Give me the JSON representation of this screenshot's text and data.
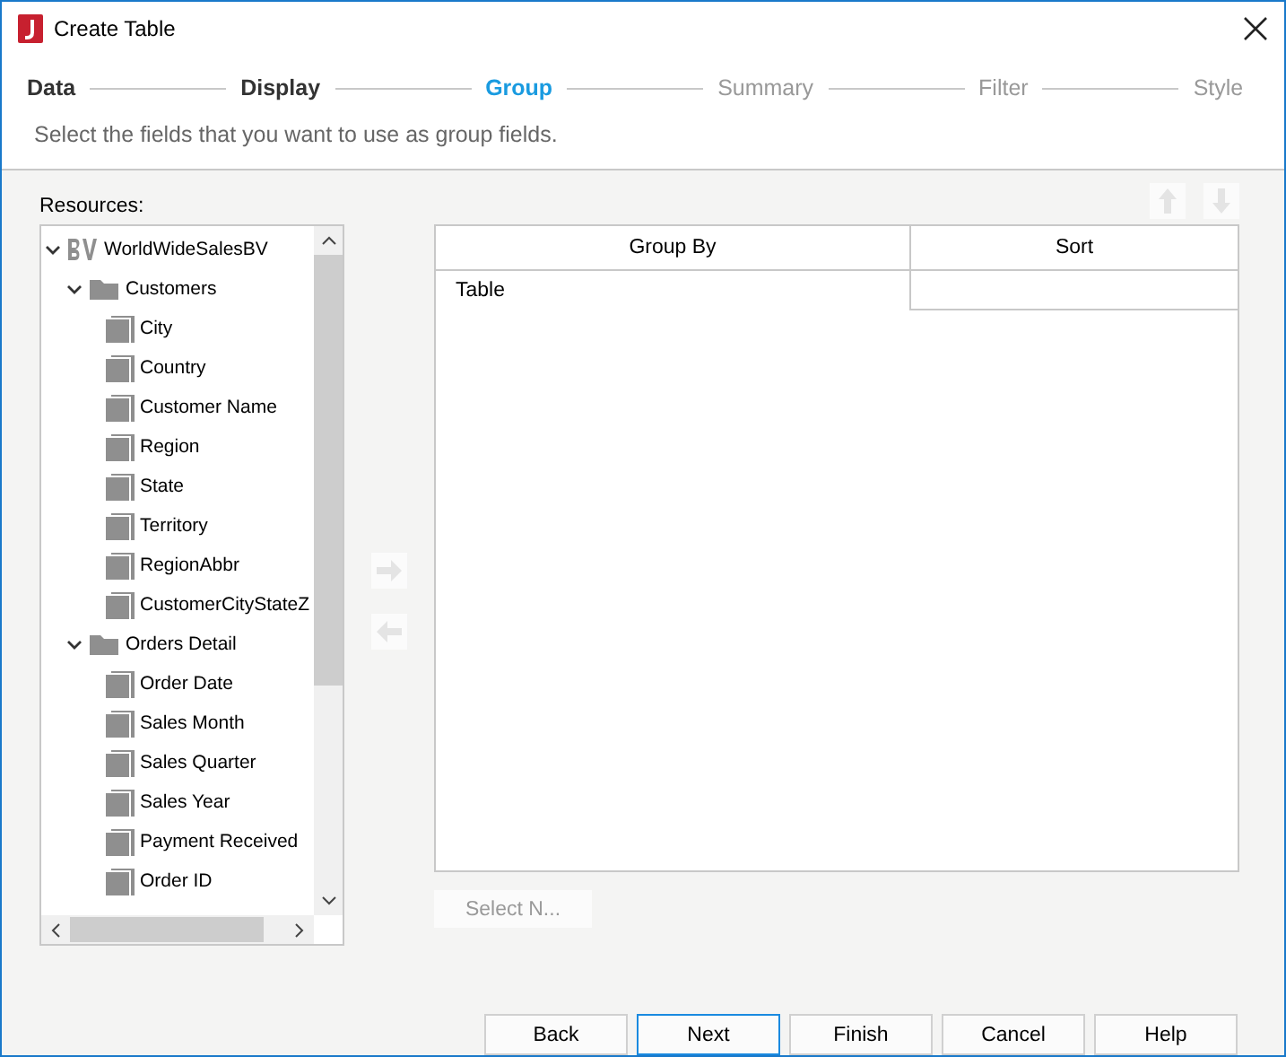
{
  "window": {
    "title": "Create Table"
  },
  "steps": [
    {
      "label": "Data",
      "selected": false
    },
    {
      "label": "Display",
      "selected": false
    },
    {
      "label": "Group",
      "selected": true
    },
    {
      "label": "Summary",
      "selected": false
    },
    {
      "label": "Filter",
      "selected": false
    },
    {
      "label": "Style",
      "selected": false
    }
  ],
  "description": "Select the fields that you want to use as group fields.",
  "resources": {
    "label": "Resources:",
    "tree": [
      {
        "label": "WorldWideSalesBV",
        "kind": "view",
        "expanded": true,
        "children": [
          {
            "label": "Customers",
            "kind": "folder",
            "expanded": true,
            "children": [
              {
                "label": "City",
                "kind": "field"
              },
              {
                "label": "Country",
                "kind": "field"
              },
              {
                "label": "Customer Name",
                "kind": "field"
              },
              {
                "label": "Region",
                "kind": "field"
              },
              {
                "label": "State",
                "kind": "field"
              },
              {
                "label": "Territory",
                "kind": "field"
              },
              {
                "label": "RegionAbbr",
                "kind": "field"
              },
              {
                "label": "CustomerCityStateZ",
                "kind": "field"
              }
            ]
          },
          {
            "label": "Orders Detail",
            "kind": "folder",
            "expanded": true,
            "children": [
              {
                "label": "Order Date",
                "kind": "field"
              },
              {
                "label": "Sales Month",
                "kind": "field"
              },
              {
                "label": "Sales Quarter",
                "kind": "field"
              },
              {
                "label": "Sales Year",
                "kind": "field"
              },
              {
                "label": "Payment Received",
                "kind": "field"
              },
              {
                "label": "Order ID",
                "kind": "field"
              }
            ]
          }
        ]
      }
    ]
  },
  "group_table": {
    "columns": [
      "Group By",
      "Sort"
    ],
    "rows": [
      [
        "Table",
        ""
      ]
    ]
  },
  "select_button": {
    "label": "Select N...",
    "disabled": true
  },
  "buttons": [
    {
      "label": "Back",
      "default": false
    },
    {
      "label": "Next",
      "default": true
    },
    {
      "label": "Finish",
      "default": false
    },
    {
      "label": "Cancel",
      "default": false
    },
    {
      "label": "Help",
      "default": false
    }
  ]
}
